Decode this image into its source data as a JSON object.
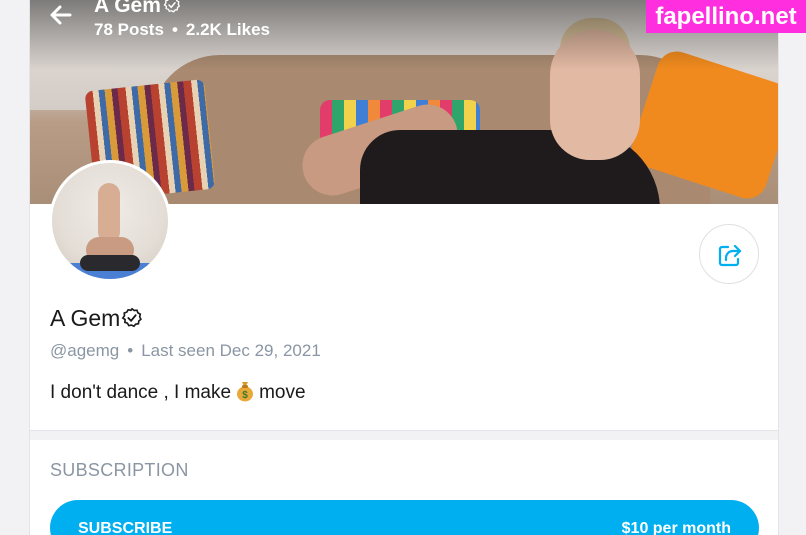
{
  "header": {
    "title": "A Gem",
    "posts": "78 Posts",
    "likes": "2.2K Likes",
    "separator": "•"
  },
  "profile": {
    "display_name": "A Gem",
    "handle": "@agemg",
    "separator": "•",
    "last_seen": "Last seen Dec 29, 2021",
    "bio_before": "I don't dance , I make",
    "bio_after": "move"
  },
  "subscription": {
    "heading": "SUBSCRIPTION",
    "button_label": "SUBSCRIBE",
    "price": "$10 per month"
  },
  "watermark": "fapellino.net",
  "icons": {
    "back": "arrow-left-icon",
    "verified": "verified-badge-icon",
    "share": "share-icon",
    "money": "money-bag-icon"
  },
  "colors": {
    "accent": "#00aff0",
    "muted_text": "#8a96a3",
    "watermark_bg": "#ff2fe0"
  }
}
